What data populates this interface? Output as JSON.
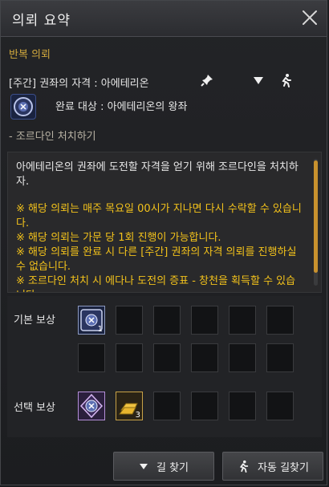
{
  "window": {
    "title": "의뢰 요약"
  },
  "section": {
    "heading": "반복 의뢰"
  },
  "quest": {
    "title": "[주간] 권좌의 자격 : 아에테리온",
    "target": "완료 대상 : 아에테리온의 왕좌",
    "objective": "- 조르다인 처치하기"
  },
  "description": {
    "main": "아에테리온의 권좌에 도전할 자격을 얻기 위해 조르다인을 처치하자.",
    "notes": [
      "※ 해당 의뢰는 매주 목요일 00시가 지나면 다시 수락할 수 있습니다.",
      "※ 해당 의뢰는 가문 당 1회 진행이 가능합니다.",
      "※ 해당 의뢰를 완료 시 다른 [주간] 권좌의 자격 의뢰를 진행하실 수 없습니다.",
      "※ 조르다인 처치 시 에다나 도전의 증표 - 창천을 획득할 수 있습니다."
    ]
  },
  "rewards": {
    "basic_label": "기본 보상",
    "choice_label": "선택 보상",
    "basic_items": [
      {
        "icon": "emblem-scroll-icon",
        "quantity": "1"
      }
    ],
    "choice_items": [
      {
        "icon": "emblem-token-icon",
        "quantity": ""
      },
      {
        "icon": "gold-bar-icon",
        "quantity": "3"
      }
    ]
  },
  "buttons": {
    "find_path": "길 찾기",
    "auto_path": "자동 길찾기"
  },
  "colors": {
    "accent": "#d2a93d",
    "note": "#f3c21b",
    "scroll": "#c8912e"
  }
}
